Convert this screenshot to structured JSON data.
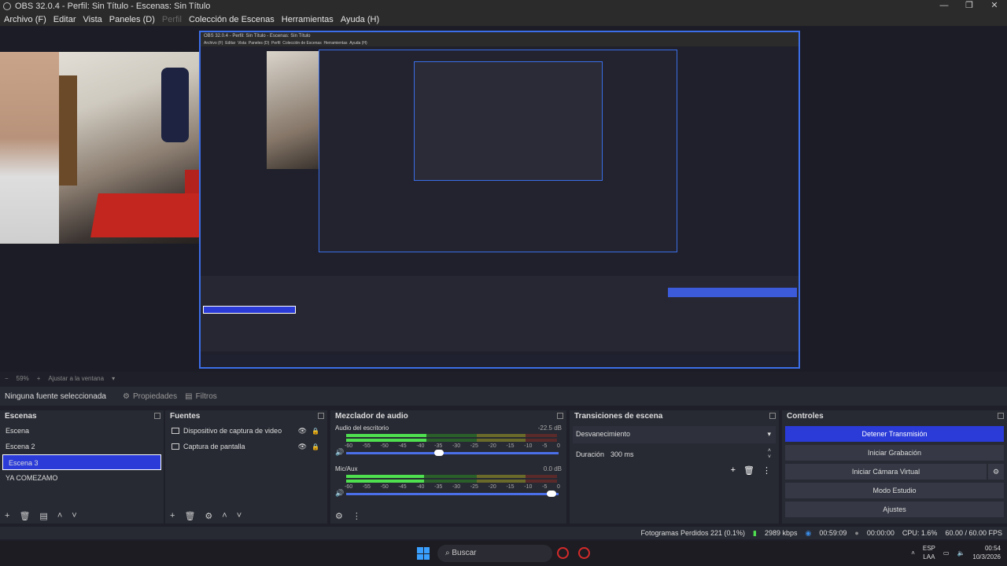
{
  "window": {
    "title": "OBS 32.0.4 - Perfil: Sin Título - Escenas: Sin Título"
  },
  "menu": [
    "Archivo (F)",
    "Editar",
    "Vista",
    "Paneles (D)",
    "Perfil",
    "Colección de Escenas",
    "Herramientas",
    "Ayuda (H)"
  ],
  "zoom": {
    "minus": "−",
    "value": "59%",
    "plus": "+",
    "fit": "Ajustar a la ventana"
  },
  "source_bar": {
    "none_selected": "Ninguna fuente seleccionada",
    "properties": "Propiedades",
    "filters": "Filtros"
  },
  "scenes": {
    "title": "Escenas",
    "items": [
      "Escena",
      "Escena 2",
      "Escena 3",
      "YA COMEZAMO"
    ]
  },
  "sources": {
    "title": "Fuentes",
    "items": [
      "Dispositivo de captura de video",
      "Captura de pantalla"
    ]
  },
  "mixer": {
    "title": "Mezclador de audio",
    "tracks": [
      {
        "name": "Audio del escritorio",
        "db": "-22.5 dB",
        "level": 0.38,
        "volume": 0.46
      },
      {
        "name": "Mic/Aux",
        "db": "0.0 dB",
        "level": 0.37,
        "volume": 0.99
      }
    ],
    "ticks": [
      "-60",
      "-55",
      "-50",
      "-45",
      "-40",
      "-35",
      "-30",
      "-25",
      "-20",
      "-15",
      "-10",
      "-5",
      "0"
    ]
  },
  "transitions": {
    "title": "Transiciones de escena",
    "selected": "Desvanecimiento",
    "duration_label": "Duración",
    "duration_value": "300 ms"
  },
  "controls": {
    "title": "Controles",
    "buttons": [
      "Detener Transmisión",
      "Iniciar Grabación",
      "Iniciar Cámara Virtual",
      "Modo Estudio",
      "Ajustes"
    ]
  },
  "status": {
    "dropped": "Fotogramas Perdidos 221 (0.1%)",
    "bitrate": "2989 kbps",
    "stream_time": "00:59:09",
    "rec_time": "00:00:00",
    "cpu": "CPU: 1.6%",
    "fps": "60.00 / 60.00 FPS"
  },
  "taskbar": {
    "search": "Buscar",
    "lang1": "ESP",
    "lang2": "LAA",
    "time": "00:54",
    "date": "10/3/2026"
  }
}
